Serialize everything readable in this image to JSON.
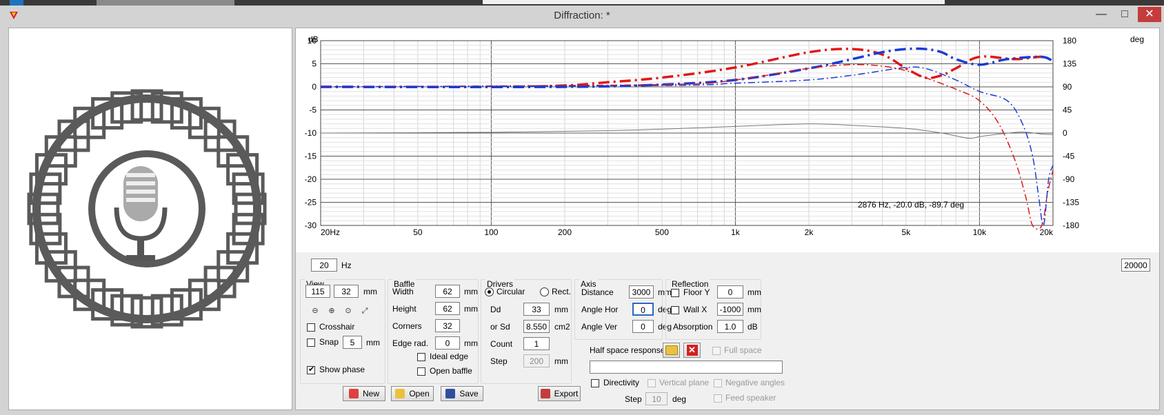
{
  "window": {
    "title": "Diffraction: *"
  },
  "plot": {
    "y_left_unit": "dB",
    "y_right_unit": "deg",
    "y_left_ticks": [
      "10",
      "5",
      "0",
      "-5",
      "-10",
      "-15",
      "-20",
      "-25",
      "-30"
    ],
    "y_right_ticks": [
      "180",
      "135",
      "90",
      "45",
      "0",
      "-45",
      "-90",
      "-135",
      "-180"
    ],
    "x_ticks": [
      {
        "label": "20Hz",
        "f": 20
      },
      {
        "label": "50",
        "f": 50
      },
      {
        "label": "100",
        "f": 100
      },
      {
        "label": "200",
        "f": 200
      },
      {
        "label": "500",
        "f": 500
      },
      {
        "label": "1k",
        "f": 1000
      },
      {
        "label": "2k",
        "f": 2000
      },
      {
        "label": "5k",
        "f": 5000
      },
      {
        "label": "10k",
        "f": 10000
      },
      {
        "label": "20k",
        "f": 20000
      }
    ],
    "cursor_readout": "2876 Hz, -20.0 dB, -89.7 deg",
    "min_freq": "20",
    "freq_unit": "Hz",
    "max_freq": "20000"
  },
  "chart_data": {
    "type": "line",
    "xlim": [
      20,
      20000
    ],
    "ylim": [
      -30,
      10
    ],
    "y2lim": [
      -180,
      180
    ],
    "x_scale": "log",
    "grid": true,
    "series": [
      {
        "color": "#e01818",
        "style": "dash-dot-bold",
        "axis": "dB",
        "points": [
          [
            20,
            0
          ],
          [
            100,
            0
          ],
          [
            200,
            0.3
          ],
          [
            300,
            1
          ],
          [
            500,
            2
          ],
          [
            1000,
            4.2
          ],
          [
            2000,
            7.5
          ],
          [
            3000,
            8.2
          ],
          [
            4000,
            7
          ],
          [
            5000,
            4
          ],
          [
            6000,
            2
          ],
          [
            7000,
            2.5
          ],
          [
            8000,
            4
          ],
          [
            10000,
            6.5
          ],
          [
            14000,
            6
          ],
          [
            18000,
            6.5
          ],
          [
            20000,
            5.5
          ]
        ]
      },
      {
        "color": "#1a3bd6",
        "style": "dash-dot-bold",
        "axis": "dB",
        "points": [
          [
            20,
            0
          ],
          [
            200,
            0
          ],
          [
            500,
            0.5
          ],
          [
            1000,
            1.5
          ],
          [
            2000,
            4
          ],
          [
            3000,
            6
          ],
          [
            4000,
            7.5
          ],
          [
            5000,
            8.2
          ],
          [
            6000,
            8.2
          ],
          [
            7000,
            7.5
          ],
          [
            8000,
            6
          ],
          [
            10000,
            4.8
          ],
          [
            13000,
            6
          ],
          [
            18000,
            6.5
          ],
          [
            20000,
            5.5
          ]
        ]
      },
      {
        "color": "#e01818",
        "style": "dash-dot-thin",
        "axis": "dB",
        "points": [
          [
            20,
            0
          ],
          [
            500,
            0.5
          ],
          [
            1000,
            1.5
          ],
          [
            2000,
            4
          ],
          [
            3000,
            4.8
          ],
          [
            4000,
            4.5
          ],
          [
            5000,
            3.5
          ],
          [
            6000,
            2
          ],
          [
            8000,
            -0.5
          ],
          [
            10000,
            -3
          ],
          [
            12000,
            -8
          ],
          [
            14000,
            -16
          ],
          [
            15500,
            -24
          ],
          [
            16500,
            -30
          ],
          [
            18000,
            -30
          ],
          [
            19000,
            -23
          ],
          [
            20000,
            -18
          ]
        ]
      },
      {
        "color": "#1a3bd6",
        "style": "dash-dot-thin",
        "axis": "dB",
        "points": [
          [
            20,
            0
          ],
          [
            500,
            0.3
          ],
          [
            1000,
            0.8
          ],
          [
            2000,
            1.5
          ],
          [
            3000,
            2.5
          ],
          [
            4000,
            3.5
          ],
          [
            5000,
            4.2
          ],
          [
            6000,
            4
          ],
          [
            8000,
            1.5
          ],
          [
            10000,
            -1
          ],
          [
            13000,
            -3
          ],
          [
            15000,
            -8
          ],
          [
            16500,
            -15
          ],
          [
            17500,
            -24
          ],
          [
            18300,
            -30
          ],
          [
            19200,
            -20
          ],
          [
            20000,
            -17
          ]
        ]
      },
      {
        "color": "#777777",
        "style": "solid",
        "axis": "deg",
        "points": [
          [
            20,
            0
          ],
          [
            100,
            1.5
          ],
          [
            300,
            4.5
          ],
          [
            600,
            9
          ],
          [
            1000,
            13
          ],
          [
            2000,
            18
          ],
          [
            3000,
            15
          ],
          [
            5000,
            9
          ],
          [
            7000,
            0
          ],
          [
            9000,
            -10
          ],
          [
            10000,
            -7
          ],
          [
            12000,
            -2
          ],
          [
            15000,
            2
          ],
          [
            18000,
            -2
          ],
          [
            20000,
            -3
          ]
        ]
      }
    ]
  },
  "view": {
    "title": "View",
    "w": "115",
    "h": "32",
    "unit": "mm",
    "crosshair": "Crosshair",
    "snap": "Snap",
    "snap_val": "5",
    "snap_unit": "mm",
    "show_phase": "Show phase"
  },
  "baffle": {
    "title": "Baffle",
    "width_lbl": "Width",
    "width": "62",
    "height_lbl": "Height",
    "height": "62",
    "corners_lbl": "Corners",
    "corners": "32",
    "edge_lbl": "Edge rad.",
    "edge": "0",
    "unit": "mm",
    "ideal_edge": "Ideal edge",
    "open_baffle": "Open baffle"
  },
  "drivers": {
    "title": "Drivers",
    "circular": "Circular",
    "rect": "Rect.",
    "dd_lbl": "Dd",
    "dd": "33",
    "dd_unit": "mm",
    "sd_lbl": "or Sd",
    "sd": "8.550",
    "sd_unit": "cm2",
    "count_lbl": "Count",
    "count": "1",
    "step_lbl": "Step",
    "step": "200",
    "step_unit": "mm"
  },
  "axis": {
    "title": "Axis",
    "distance_lbl": "Distance",
    "distance": "3000",
    "distance_unit": "mm",
    "anglehor_lbl": "Angle Hor",
    "anglehor": "0",
    "anglever_lbl": "Angle Ver",
    "anglever": "0",
    "deg": "deg"
  },
  "reflection": {
    "title": "Reflection",
    "floor_lbl": "Floor Y",
    "floor": "0",
    "wall_lbl": "Wall  X",
    "wall": "-1000",
    "unit": "mm",
    "absorption_lbl": "Absorption",
    "absorption": "1.0",
    "absorption_unit": "dB"
  },
  "halfspace": {
    "label": "Half space response",
    "full_space": "Full space",
    "path": ""
  },
  "directivity": {
    "label": "Directivity",
    "vertical": "Vertical plane",
    "negative": "Negative angles",
    "step_lbl": "Step",
    "step": "10",
    "step_unit": "deg",
    "feed": "Feed speaker"
  },
  "buttons": {
    "new": "New",
    "open": "Open",
    "save": "Save",
    "export": "Export"
  }
}
